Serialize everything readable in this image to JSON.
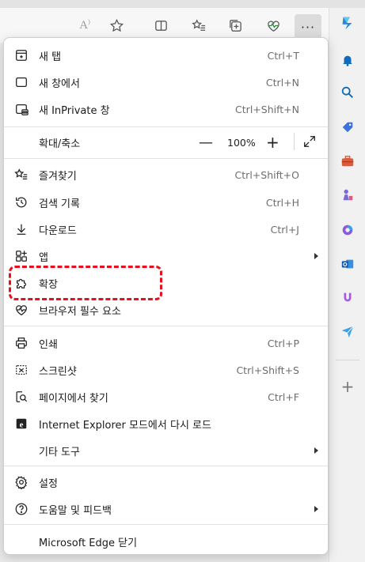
{
  "colors": {
    "highlight": "#e8101e",
    "accent": "#0f6cbd"
  },
  "toolbar": {
    "icons": [
      "read-aloud-icon",
      "favorite-star-icon",
      "split-screen-icon",
      "favorites-list-icon",
      "collections-icon",
      "browser-essentials-icon"
    ],
    "more_label": "···"
  },
  "menu": {
    "new_tab": {
      "label": "새 탭",
      "shortcut": "Ctrl+T"
    },
    "new_window": {
      "label": "새 창에서",
      "shortcut": "Ctrl+N"
    },
    "new_inprivate": {
      "label": "새 InPrivate 창",
      "shortcut": "Ctrl+Shift+N"
    },
    "zoom": {
      "label": "확대/축소",
      "minus": "—",
      "value": "100%",
      "plus": "+"
    },
    "favorites": {
      "label": "즐겨찾기",
      "shortcut": "Ctrl+Shift+O"
    },
    "history": {
      "label": "검색 기록",
      "shortcut": "Ctrl+H"
    },
    "downloads": {
      "label": "다운로드",
      "shortcut": "Ctrl+J"
    },
    "apps": {
      "label": "앱"
    },
    "extensions": {
      "label": "확장"
    },
    "browser_essentials": {
      "label": "브라우저 필수 요소"
    },
    "print": {
      "label": "인쇄",
      "shortcut": "Ctrl+P"
    },
    "screenshot": {
      "label": "스크린샷",
      "shortcut": "Ctrl+Shift+S"
    },
    "find": {
      "label": "페이지에서 찾기",
      "shortcut": "Ctrl+F"
    },
    "ie_mode": {
      "label": "Internet Explorer 모드에서 다시 로드"
    },
    "more_tools": {
      "label": "기타 도구"
    },
    "settings": {
      "label": "설정"
    },
    "help": {
      "label": "도움말 및 피드백"
    },
    "close": {
      "label": "Microsoft Edge 닫기"
    }
  }
}
